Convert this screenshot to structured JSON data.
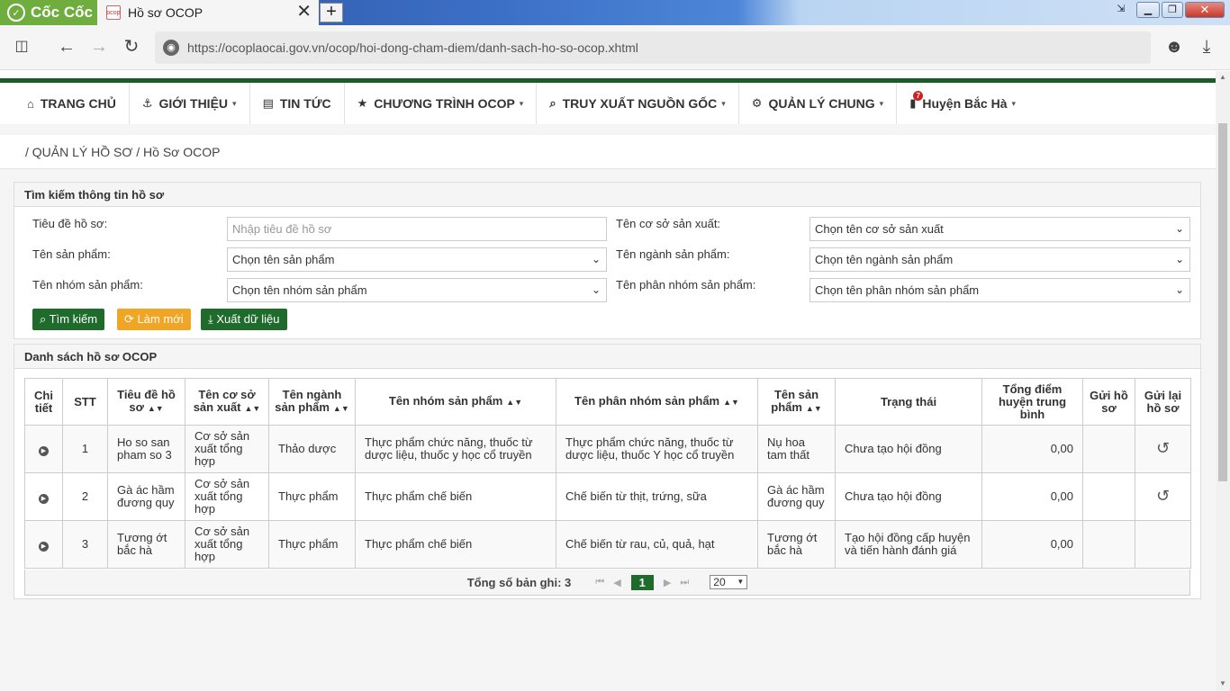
{
  "browser": {
    "brand": "Cốc Cốc",
    "tab_title": "Hồ sơ OCOP",
    "favicon_text": "ocop",
    "url": "https://ocoplaocai.gov.vn/ocop/hoi-dong-cham-diem/danh-sach-ho-so-ocop.xhtml"
  },
  "menu": {
    "items": [
      {
        "label": "TRANG CHỦ",
        "icon": "home-icon",
        "caret": false
      },
      {
        "label": "GIỚI THIỆU",
        "icon": "anchor-icon",
        "caret": true
      },
      {
        "label": "TIN TỨC",
        "icon": "newspaper-icon",
        "caret": false
      },
      {
        "label": "CHƯƠNG TRÌNH OCOP",
        "icon": "star-icon",
        "caret": true
      },
      {
        "label": "TRUY XUẤT NGUỒN GỐC",
        "icon": "search-icon",
        "caret": true
      },
      {
        "label": "QUẢN LÝ CHUNG",
        "icon": "gear-icon",
        "caret": true
      }
    ],
    "user": {
      "label": "Huyện Bắc Hà",
      "badge": "7"
    }
  },
  "breadcrumb": "/ QUẢN LÝ HỒ SƠ / Hồ Sơ OCOP",
  "search": {
    "title": "Tìm kiếm thông tin hồ sơ",
    "fields": {
      "title_label": "Tiêu đề hồ sơ:",
      "title_placeholder": "Nhập tiêu đề hồ sơ",
      "facility_label": "Tên cơ sở sản xuất:",
      "facility_value": "Chọn tên cơ sở sản xuất",
      "product_label": "Tên sản phẩm:",
      "product_value": "Chọn tên sản phẩm",
      "industry_label": "Tên ngành sản phẩm:",
      "industry_value": "Chọn tên ngành sản phẩm",
      "group_label": "Tên nhóm sản phẩm:",
      "group_value": "Chọn tên nhóm sản phẩm",
      "subgroup_label": "Tên phân nhóm sản phẩm:",
      "subgroup_value": "Chọn tên phân nhóm sản phẩm"
    },
    "buttons": {
      "search": "Tìm kiếm",
      "reset": "Làm mới",
      "export": "Xuất dữ liệu"
    }
  },
  "list": {
    "title": "Danh sách hồ sơ OCOP",
    "columns": [
      "Chi tiết",
      "STT",
      "Tiêu đề hồ sơ",
      "Tên cơ sở sản xuất",
      "Tên ngành sản phẩm",
      "Tên nhóm sản phẩm",
      "Tên phân nhóm sản phẩm",
      "Tên sản phẩm",
      "Trạng thái",
      "Tổng điểm huyện trung bình",
      "Gửi hồ sơ",
      "Gửi lại hồ sơ"
    ],
    "rows": [
      {
        "stt": "1",
        "title": "Ho so san pham so 3",
        "facility": "Cơ sở sản xuất tổng hợp",
        "industry": "Thảo dược",
        "group": "Thực phẩm chức năng, thuốc từ dược liệu, thuốc y học cổ truyền",
        "subgroup": "Thực phẩm chức năng, thuốc từ dược liệu, thuốc Y học cổ truyền",
        "product": "Nụ hoa tam thất",
        "status": "Chưa tạo hội đồng",
        "score": "0,00",
        "resend": true
      },
      {
        "stt": "2",
        "title": "Gà ác hầm đương quy",
        "facility": "Cơ sở sản xuất tổng hợp",
        "industry": "Thực phẩm",
        "group": "Thực phẩm chế biến",
        "subgroup": "Chế biến từ thịt, trứng, sữa",
        "product": "Gà ác hầm đương quy",
        "status": "Chưa tạo hội đồng",
        "score": "0,00",
        "resend": true
      },
      {
        "stt": "3",
        "title": "Tương ớt bắc hà",
        "facility": "Cơ sở sản xuất tổng hợp",
        "industry": "Thực phẩm",
        "group": "Thực phẩm chế biến",
        "subgroup": "Chế biến từ rau, củ, quả, hạt",
        "product": "Tương ớt bắc hà",
        "status": "Tạo hội đồng cấp huyện và tiến hành đánh giá",
        "score": "0,00",
        "resend": false
      }
    ],
    "pager": {
      "total_label": "Tổng số bản ghi: 3",
      "current_page": "1",
      "page_size": "20"
    }
  }
}
